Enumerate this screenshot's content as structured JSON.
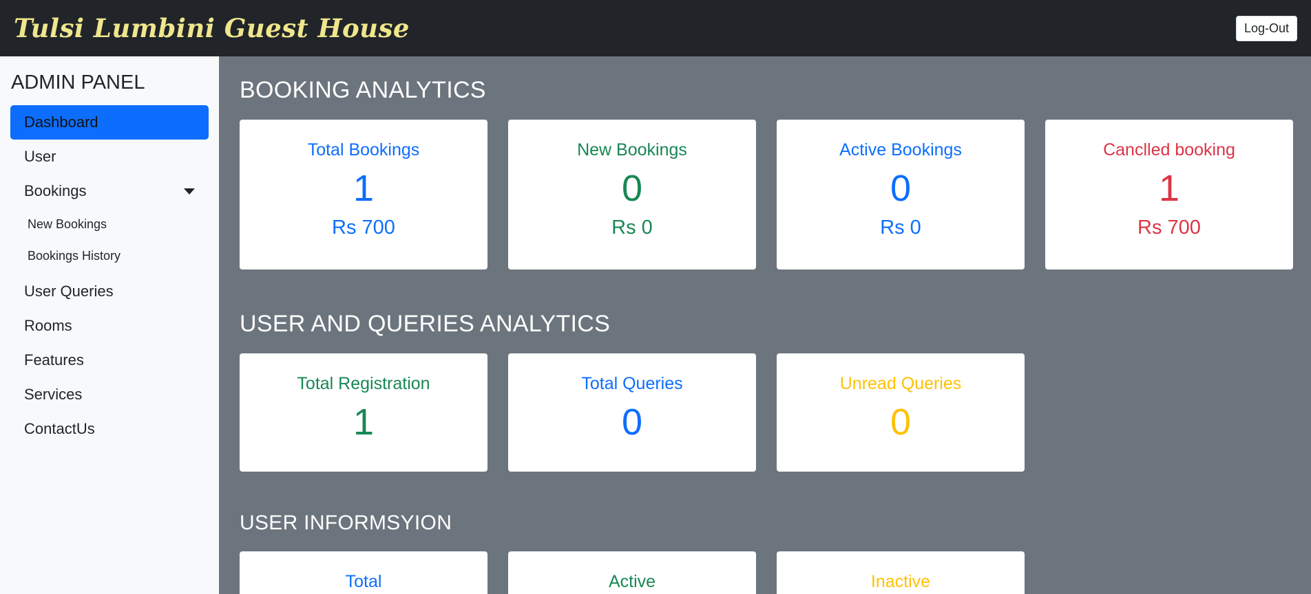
{
  "header": {
    "brand": "Tulsi Lumbini Guest House",
    "logout_label": "Log-Out"
  },
  "sidebar": {
    "title": "ADMIN PANEL",
    "items": [
      {
        "label": "Dashboard"
      },
      {
        "label": "User"
      },
      {
        "label": "Bookings"
      },
      {
        "label": "User Queries"
      },
      {
        "label": "Rooms"
      },
      {
        "label": "Features"
      },
      {
        "label": "Services"
      },
      {
        "label": "ContactUs"
      }
    ],
    "bookings_sub": [
      {
        "label": "New Bookings"
      },
      {
        "label": "Bookings History"
      }
    ]
  },
  "booking_analytics": {
    "title": "BOOKING ANALYTICS",
    "cards": [
      {
        "title": "Total Bookings",
        "count": "1",
        "amount": "Rs 700",
        "color": "#0d6efd"
      },
      {
        "title": "New Bookings",
        "count": "0",
        "amount": "Rs 0",
        "color": "#198754"
      },
      {
        "title": "Active Bookings",
        "count": "0",
        "amount": "Rs 0",
        "color": "#0d6efd"
      },
      {
        "title": "Canclled booking",
        "count": "1",
        "amount": "Rs 700",
        "color": "#dc3545"
      }
    ]
  },
  "user_queries_analytics": {
    "title": "USER AND QUERIES ANALYTICS",
    "cards": [
      {
        "title": "Total Registration",
        "count": "1",
        "color": "#198754"
      },
      {
        "title": "Total Queries",
        "count": "0",
        "color": "#0d6efd"
      },
      {
        "title": "Unread Queries",
        "count": "0",
        "color": "#ffc107"
      }
    ]
  },
  "user_information": {
    "title": "USER INFORMSYION",
    "cards": [
      {
        "title": "Total",
        "color": "#0d6efd"
      },
      {
        "title": "Active",
        "color": "#198754"
      },
      {
        "title": "Inactive",
        "color": "#ffc107"
      }
    ]
  }
}
